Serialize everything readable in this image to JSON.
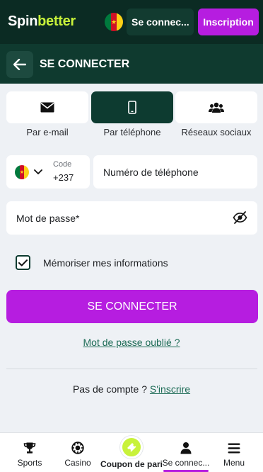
{
  "header": {
    "logo_spin": "Spin",
    "logo_better": "better",
    "flag_icon": "cameroon-flag-icon",
    "login_label": "Se connec...",
    "register_label": "Inscription"
  },
  "subheader": {
    "back_icon": "arrow-left-icon",
    "title": "SE CONNECTER"
  },
  "methods": [
    {
      "label": "Par e-mail",
      "icon": "envelope-icon",
      "active": false
    },
    {
      "label": "Par téléphone",
      "icon": "smartphone-icon",
      "active": true
    },
    {
      "label": "Réseaux sociaux",
      "icon": "users-icon",
      "active": false
    }
  ],
  "form": {
    "code_label": "Code",
    "code_value": "+237",
    "phone_placeholder": "Numéro de téléphone",
    "password_placeholder": "Mot de passe*",
    "remember_label": "Mémoriser mes informations",
    "remember_checked": true,
    "submit_label": "SE CONNECTER",
    "forgot_label": "Mot de passe oublié ?",
    "no_account_text": "Pas de compte ? ",
    "signup_label": "S'inscrire"
  },
  "nav": {
    "items": [
      {
        "label": "Sports",
        "icon": "trophy-icon"
      },
      {
        "label": "Casino",
        "icon": "poker-chip-icon"
      },
      {
        "label": "Coupon de pari",
        "icon": "ticket-icon"
      },
      {
        "label": "Se connec...",
        "icon": "user-icon",
        "active": true
      },
      {
        "label": "Menu",
        "icon": "hamburger-icon"
      }
    ]
  },
  "colors": {
    "header_bg": "#0b2b23",
    "accent_purple": "#b61de0",
    "accent_lime": "#c8f23a",
    "link_green": "#1c6b55"
  }
}
